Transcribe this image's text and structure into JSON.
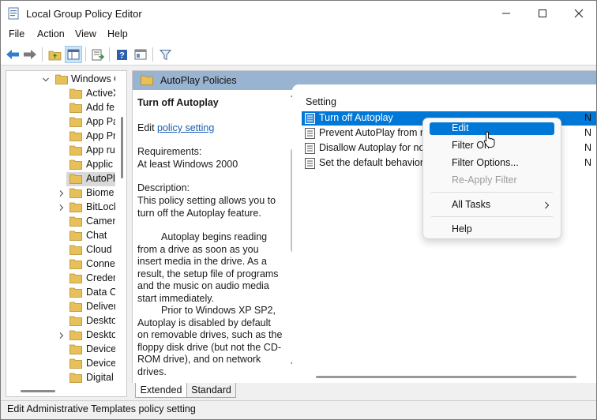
{
  "window": {
    "title": "Local Group Policy Editor"
  },
  "menu": [
    "File",
    "Action",
    "View",
    "Help"
  ],
  "tree": {
    "items": [
      {
        "label": "Windows C",
        "expandable": "down",
        "selected": false
      },
      {
        "label": "ActiveX",
        "expandable": "",
        "selected": false
      },
      {
        "label": "Add fe",
        "expandable": "",
        "selected": false
      },
      {
        "label": "App Pa",
        "expandable": "",
        "selected": false
      },
      {
        "label": "App Pr",
        "expandable": "",
        "selected": false
      },
      {
        "label": "App ru",
        "expandable": "",
        "selected": false
      },
      {
        "label": "Applic",
        "expandable": "",
        "selected": false
      },
      {
        "label": "AutoPl",
        "expandable": "",
        "selected": true
      },
      {
        "label": "Biome",
        "expandable": "right",
        "selected": false
      },
      {
        "label": "BitLock",
        "expandable": "right",
        "selected": false
      },
      {
        "label": "Camer",
        "expandable": "",
        "selected": false
      },
      {
        "label": "Chat",
        "expandable": "",
        "selected": false
      },
      {
        "label": "Cloud",
        "expandable": "",
        "selected": false
      },
      {
        "label": "Conne",
        "expandable": "",
        "selected": false
      },
      {
        "label": "Creder",
        "expandable": "",
        "selected": false
      },
      {
        "label": "Data C",
        "expandable": "",
        "selected": false
      },
      {
        "label": "Deliver",
        "expandable": "",
        "selected": false
      },
      {
        "label": "Deskto",
        "expandable": "",
        "selected": false
      },
      {
        "label": "Deskto",
        "expandable": "right",
        "selected": false
      },
      {
        "label": "Device",
        "expandable": "",
        "selected": false
      },
      {
        "label": "Device",
        "expandable": "",
        "selected": false
      },
      {
        "label": "Digital",
        "expandable": "",
        "selected": false
      }
    ]
  },
  "details": {
    "header": "AutoPlay Policies",
    "policy_title": "Turn off Autoplay",
    "edit_prefix": "Edit ",
    "edit_link": "policy setting ",
    "requirements_label": "Requirements:",
    "requirements_value": "At least Windows 2000",
    "description_label": "Description:",
    "description_p1": "This policy setting allows you to turn off the Autoplay feature.",
    "description_p2": "Autoplay begins reading from a drive as soon as you insert media in the drive. As a result, the setup file of programs and the music on audio media start immediately.",
    "description_p3": "Prior to Windows XP SP2, Autoplay is disabled by default on removable drives, such as the floppy disk drive (but not the CD-ROM drive), and on network drives."
  },
  "list": {
    "column_setting": "Setting",
    "rows": [
      {
        "label": "Turn off Autoplay",
        "state": "N",
        "selected": true
      },
      {
        "label": "Prevent AutoPlay from re",
        "state": "N",
        "selected": false
      },
      {
        "label": "Disallow Autoplay for nor",
        "state": "N",
        "selected": false
      },
      {
        "label": "Set the default behavior f",
        "state": "N",
        "selected": false
      }
    ]
  },
  "context_menu": {
    "items": [
      {
        "label": "Edit",
        "state": "highlight",
        "submenu": false
      },
      {
        "label": "Filter On",
        "state": "normal",
        "submenu": false
      },
      {
        "label": "Filter Options...",
        "state": "normal",
        "submenu": false
      },
      {
        "label": "Re-Apply Filter",
        "state": "disabled",
        "submenu": false
      },
      {
        "label": "All Tasks",
        "state": "normal",
        "submenu": true
      },
      {
        "label": "Help",
        "state": "normal",
        "submenu": false
      }
    ]
  },
  "tabs": {
    "extended": "Extended",
    "standard": "Standard",
    "active": "Extended"
  },
  "status": {
    "text": "Edit Administrative Templates policy setting"
  },
  "colors": {
    "accent": "#0078d7",
    "header_band": "#99b4d1",
    "folder": "#e8c05a",
    "link": "#1a5fb4"
  }
}
